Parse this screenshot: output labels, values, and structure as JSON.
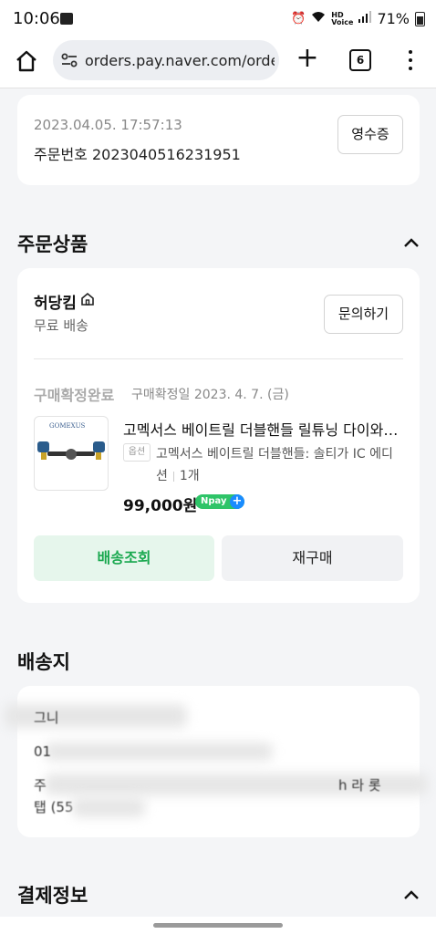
{
  "status_bar": {
    "time": "10:06",
    "battery": "71%",
    "icons": [
      "gallery-icon",
      "alarm-icon",
      "wifi-icon",
      "hd-voice-icon",
      "signal-icon",
      "battery-icon"
    ]
  },
  "browser": {
    "url": "orders.pay.naver.com/order",
    "tab_count": "6",
    "icons": [
      "home-icon",
      "site-settings-icon",
      "plus-icon",
      "tabs-icon",
      "more-vert-icon"
    ]
  },
  "order_info": {
    "date": "2023.04.05. 17:57:13",
    "order_number": "주문번호 2023040516231951",
    "receipt_button": "영수증"
  },
  "ordered_products": {
    "section_title": "주문상품",
    "seller": "허당킴",
    "shipping": "무료 배송",
    "inquiry_button": "문의하기",
    "confirm_status": "구매확정완료",
    "confirm_date": "구매확정일 2023. 4. 7. (금)",
    "thumbnail_brand": "GOMEXUS",
    "product_name": "고멕서스 베이트릴 더블핸들 릴튜닝 다이와 아부가르시아",
    "option_badge": "옵션",
    "option_text": "고멕서스 베이트릴 더블핸들: 솔티가 IC 에디션",
    "quantity": "1개",
    "price": "99,000원",
    "npay_label": "Npay",
    "npay_plus": "+",
    "track_button": "배송조회",
    "reorder_button": "재구매"
  },
  "shipping_address": {
    "section_title": "배송지",
    "frag_1": "그니",
    "frag_2": "01",
    "frag_3": "주",
    "frag_4": "h 라 롯",
    "frag_5": "탭 (55"
  },
  "payment": {
    "section_title": "결제정보"
  },
  "colors": {
    "accent_green": "#18a84e",
    "npay_green": "#2ec468",
    "background": "#f4f5f7"
  }
}
